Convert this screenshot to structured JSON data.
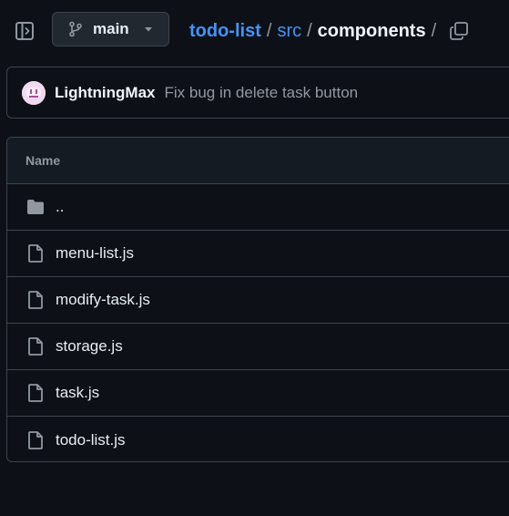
{
  "header": {
    "branch": "main",
    "breadcrumb": {
      "root": "todo-list",
      "segment": "src",
      "current": "components",
      "separator": "/"
    }
  },
  "commit": {
    "author": "LightningMax",
    "message": "Fix bug in delete task button"
  },
  "table": {
    "column_name": "Name",
    "parent_dir": "..",
    "files": [
      {
        "name": "menu-list.js",
        "icon": "file-icon"
      },
      {
        "name": "modify-task.js",
        "icon": "file-icon"
      },
      {
        "name": "storage.js",
        "icon": "file-icon"
      },
      {
        "name": "task.js",
        "icon": "file-icon"
      },
      {
        "name": "todo-list.js",
        "icon": "file-icon"
      }
    ]
  },
  "colors": {
    "background": "#0d1117",
    "link": "#4493f8",
    "muted": "#9198a1",
    "border": "#3d444d"
  }
}
